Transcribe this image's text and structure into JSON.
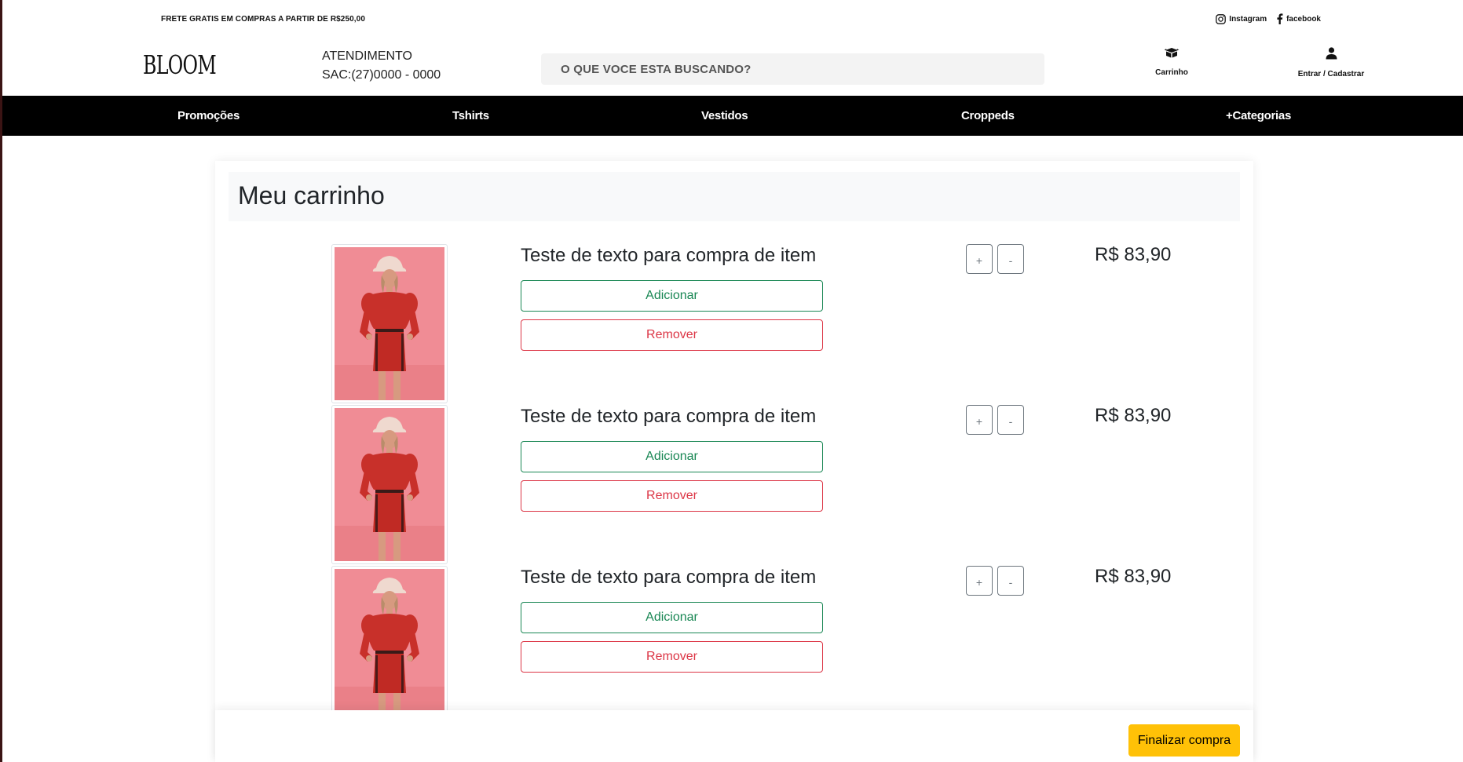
{
  "topbar": {
    "promo": "FRETE GRATIS EM COMPRAS A PARTIR DE R$250,00",
    "instagram_label": "Instagram",
    "facebook_label": "facebook"
  },
  "header": {
    "logo": "BLOOM",
    "contact_line1": "ATENDIMENTO",
    "contact_line2": "SAC:(27)0000 - 0000",
    "search_placeholder": "O QUE VOCE ESTA BUSCANDO?",
    "cart_label": "Carrinho",
    "login_label": "Entrar / Cadastrar"
  },
  "nav": {
    "items": [
      {
        "label": "Promoções"
      },
      {
        "label": "Tshirts"
      },
      {
        "label": "Vestidos"
      },
      {
        "label": "Croppeds"
      },
      {
        "label": "+Categorias"
      }
    ]
  },
  "cart": {
    "title": "Meu carrinho",
    "items": [
      {
        "title": "Teste de texto para compra de item",
        "add_label": "Adicionar",
        "remove_label": "Remover",
        "plus": "+",
        "minus": "-",
        "price": "R$ 83,90"
      },
      {
        "title": "Teste de texto para compra de item",
        "add_label": "Adicionar",
        "remove_label": "Remover",
        "plus": "+",
        "minus": "-",
        "price": "R$ 83,90"
      },
      {
        "title": "Teste de texto para compra de item",
        "add_label": "Adicionar",
        "remove_label": "Remover",
        "plus": "+",
        "minus": "-",
        "price": "R$ 83,90"
      }
    ],
    "checkout_label": "Finalizar compra"
  },
  "colors": {
    "nav_bg": "#000000",
    "success": "#198754",
    "danger": "#dc3545",
    "warning": "#ffc107",
    "product_bg": "#f08c95",
    "product_outfit": "#c8302a"
  },
  "icons": {
    "instagram": "instagram-icon",
    "facebook": "facebook-icon",
    "cart": "cart-icon",
    "user": "user-icon"
  }
}
